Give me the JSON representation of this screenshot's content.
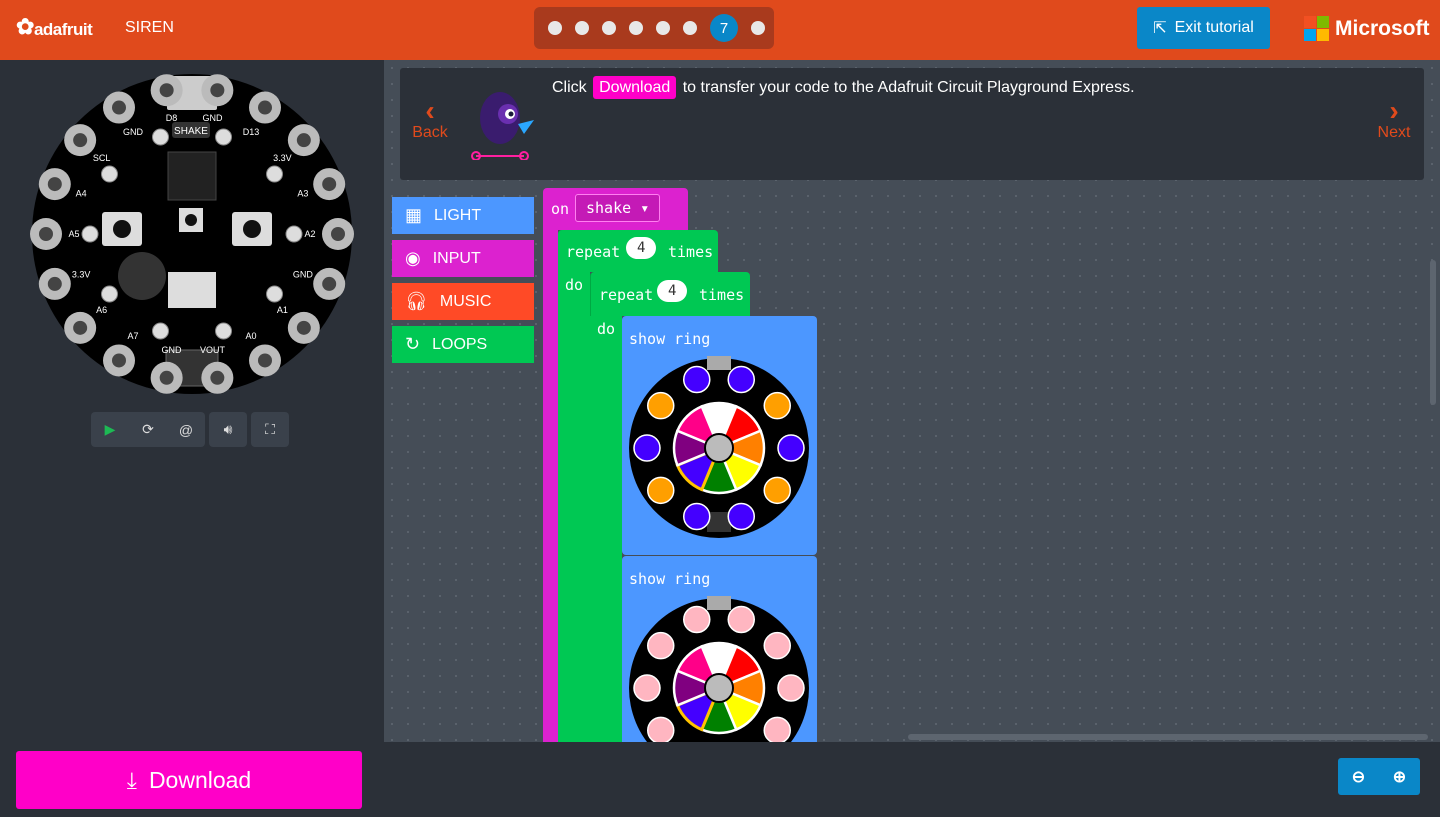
{
  "header": {
    "logo": "adafruit",
    "project_title": "SIREN",
    "steps_total": 8,
    "current_step": "7",
    "exit_tutorial": "Exit tutorial",
    "microsoft": "Microsoft"
  },
  "colors": {
    "header": "#e04a1c",
    "accent": "#0a87c8",
    "download": "#ff00c8",
    "events": "#dc22cf",
    "loops": "#00c853",
    "light": "#4c97ff",
    "music": "#ff4a26"
  },
  "tutorial": {
    "back": "Back",
    "next": "Next",
    "before": "Click",
    "highlight": "Download",
    "after": "to transfer your code to the Adafruit Circuit Playground Express."
  },
  "toolbox": [
    {
      "label": "LIGHT",
      "icon": "grid-icon",
      "color": "#4c97ff"
    },
    {
      "label": "INPUT",
      "icon": "target-icon",
      "color": "#dc22cf"
    },
    {
      "label": "MUSIC",
      "icon": "headphones-icon",
      "color": "#ff4a26"
    },
    {
      "label": "LOOPS",
      "icon": "refresh-icon",
      "color": "#00c853"
    }
  ],
  "blocks": {
    "on": "on",
    "event": "shake",
    "repeat": "repeat",
    "times": "times",
    "do": "do",
    "outer_count": "4",
    "inner_count": "4",
    "show_ring": "show ring",
    "ring1": [
      "#4400ff",
      "#ff9f00",
      "#4400ff",
      "#ff9f00",
      "#4400ff",
      "#4400ff",
      "#ff9f00",
      "#4400ff",
      "#ff9f00",
      "#4400ff"
    ],
    "ring2": [
      "#ffb6c1",
      "#ffb6c1",
      "#ffb6c1",
      "#ffb6c1",
      "#ffb6c1",
      "#ffb6c1",
      "#ffb6c1",
      "#ffb6c1",
      "#ffb6c1",
      "#ffb6c1"
    ],
    "palette": [
      "#ffffff",
      "#ff0000",
      "#ff8000",
      "#ffff00",
      "#008000",
      "#4400ff",
      "#800080",
      "#ff0088"
    ]
  },
  "simulator": {
    "shake_label": "SHAKE",
    "controls": [
      "play-icon",
      "restart-icon",
      "slow-motion-icon",
      "sound-icon",
      "fullscreen-icon"
    ],
    "pins": [
      "GND",
      "D13",
      "3.3V",
      "A3",
      "A2",
      "GND",
      "A1",
      "A0",
      "VOUT",
      "GND",
      "A7",
      "A6",
      "3.3V",
      "A5",
      "A4",
      "SCL",
      "GND",
      "D8"
    ]
  },
  "download": "Download"
}
